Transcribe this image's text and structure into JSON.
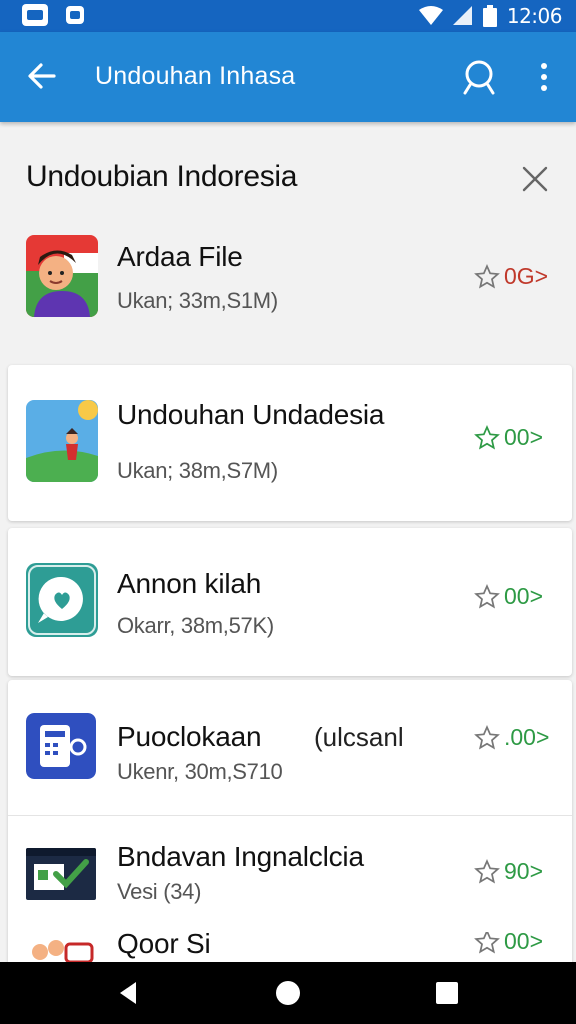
{
  "status_bar": {
    "time": "12:06"
  },
  "app_bar": {
    "title": "Undouhan Inhasa"
  },
  "section": {
    "title": "Undoubian Indoresia"
  },
  "items": [
    {
      "name": "Ardaa File",
      "meta": "Ukan; 33m,S1M)",
      "rating": "0G>",
      "rating_color": "#c0392b",
      "icon": "person-avatar-icon"
    },
    {
      "name": "Undouhan Undadesia",
      "meta": "Ukan; 38m,S7M)",
      "rating": "00>",
      "rating_color": "#2e9a45",
      "icon": "landscape-icon"
    },
    {
      "name": "Annon kilah",
      "meta": "Okarr, 38m,57K)",
      "rating": "00>",
      "rating_color": "#2e9a45",
      "icon": "chat-heart-icon"
    },
    {
      "name": "Puoclokaan",
      "tag": "(ulcsanl",
      "meta": "Ukenr, 30m,S710",
      "rating": ".00>",
      "rating_color": "#2e9a45",
      "icon": "phone-device-icon"
    },
    {
      "name": "Bndavan Ingnalclcia",
      "meta": "Vesi (34)",
      "rating": "90>",
      "rating_color": "#2e9a45",
      "icon": "checkbox-window-icon"
    },
    {
      "name": "Qoor Si",
      "meta": "",
      "rating": "00>",
      "rating_color": "#2e9a45",
      "icon": "people-icon"
    }
  ],
  "colors": {
    "app_bar": "#2286d4",
    "status_bar": "#1565c0",
    "rating_green": "#2e9a45",
    "rating_red": "#c0392b"
  }
}
